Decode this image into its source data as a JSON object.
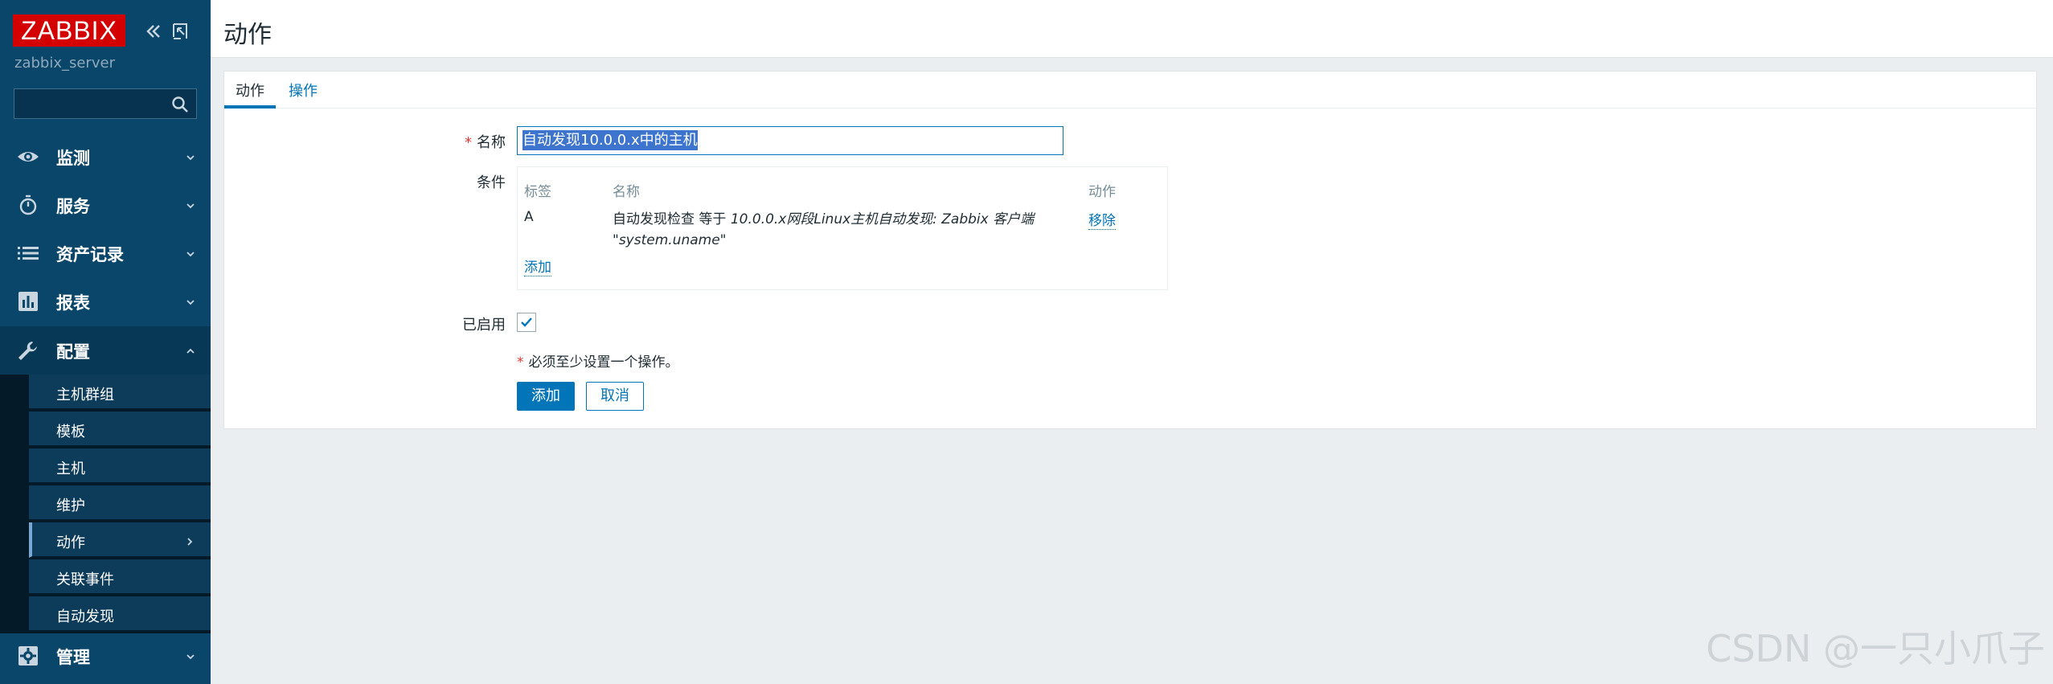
{
  "app": {
    "logo_text": "ZABBIX",
    "server_name": "zabbix_server",
    "search_value": ""
  },
  "sidebar": {
    "menu": [
      {
        "label": "监测",
        "icon": "eye-icon"
      },
      {
        "label": "服务",
        "icon": "stopwatch-icon"
      },
      {
        "label": "资产记录",
        "icon": "list-icon"
      },
      {
        "label": "报表",
        "icon": "bar-chart-icon"
      },
      {
        "label": "配置",
        "icon": "wrench-icon"
      },
      {
        "label": "管理",
        "icon": "gear-icon"
      }
    ],
    "config_submenu": [
      {
        "label": "主机群组"
      },
      {
        "label": "模板"
      },
      {
        "label": "主机"
      },
      {
        "label": "维护"
      },
      {
        "label": "动作"
      },
      {
        "label": "关联事件"
      },
      {
        "label": "自动发现"
      }
    ]
  },
  "header": {
    "title": "动作"
  },
  "tabs": [
    {
      "label": "动作",
      "active": true
    },
    {
      "label": "操作",
      "active": false
    }
  ],
  "form": {
    "name_label": "名称",
    "name_value": "自动发现10.0.0.x中的主机",
    "conditions_label": "条件",
    "conditions_table": {
      "headers": [
        "标签",
        "名称",
        "动作"
      ],
      "rows": [
        {
          "tag": "A",
          "name_prefix": "自动发现检查 等于 ",
          "name_italic_line1": "10.0.0.x网段Linux主机自动发现: Zabbix 客户端",
          "name_italic_line2": "\"system.uname\"",
          "action": "移除"
        }
      ],
      "add_link": "添加"
    },
    "enabled_label": "已启用",
    "enabled": true,
    "note": "必须至少设置一个操作。",
    "add_button": "添加",
    "cancel_button": "取消"
  },
  "watermark": "CSDN @一只小爪子",
  "colors": {
    "sidebar_bg": "#0a466a",
    "logo_red": "#d40000",
    "accent_blue": "#0275b8",
    "required_red": "#e33734"
  }
}
